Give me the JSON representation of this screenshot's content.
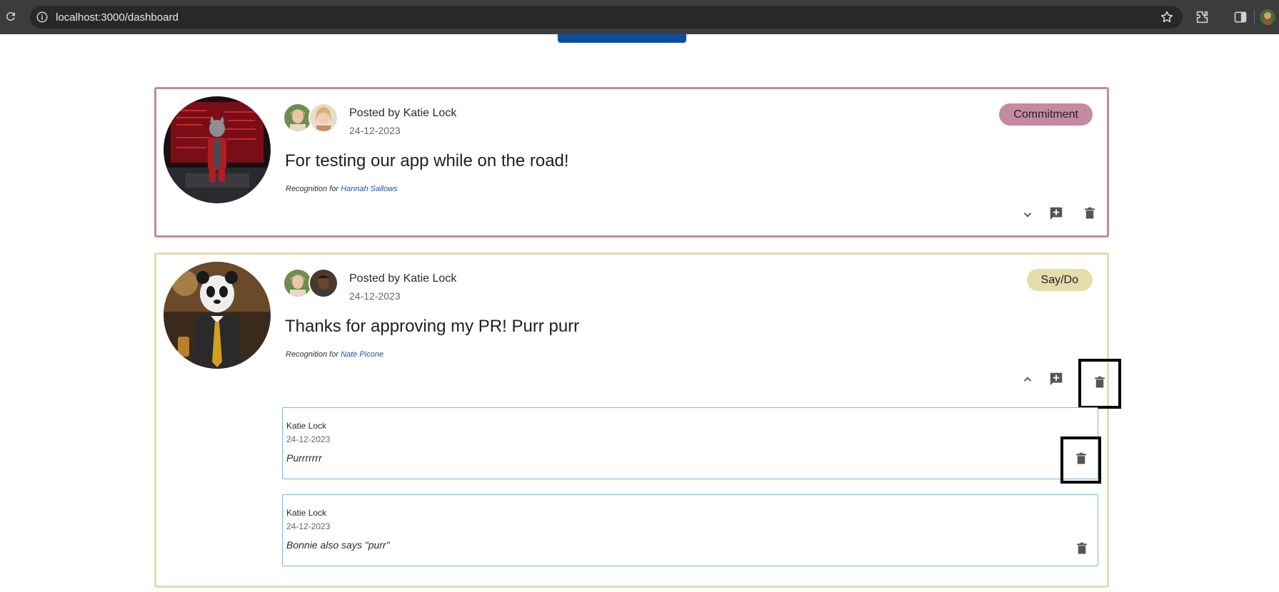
{
  "browser": {
    "url": "localhost:3000/dashboard"
  },
  "posts": [
    {
      "posted_by": "Posted by Katie Lock",
      "date": "24-12-2023",
      "message": "For testing our app while on the road!",
      "recognition_prefix": "Recognition for",
      "recognition_name": "Hannah Sallows",
      "badge": "Commitment",
      "badge_color": "#c48aa1",
      "expanded": false
    },
    {
      "posted_by": "Posted by Katie Lock",
      "date": "24-12-2023",
      "message": "Thanks for approving my PR! Purr purr",
      "recognition_prefix": "Recognition for",
      "recognition_name": "Nate Picone",
      "badge": "Say/Do",
      "badge_color": "#e6dbab",
      "expanded": true,
      "comments": [
        {
          "author": "Katie Lock",
          "date": "24-12-2023",
          "text": "Purrrrrrr"
        },
        {
          "author": "Katie Lock",
          "date": "24-12-2023",
          "text": "Bonnie also says \"purr\""
        }
      ]
    }
  ],
  "icons": {
    "reload": "reload-icon",
    "info": "site-info-icon",
    "star": "bookmark-star-icon",
    "extensions": "extensions-icon",
    "sidepanel": "side-panel-icon",
    "expand": "chevron-down-icon",
    "collapse": "chevron-up-icon",
    "add_comment": "add-comment-icon",
    "delete": "trash-icon"
  }
}
